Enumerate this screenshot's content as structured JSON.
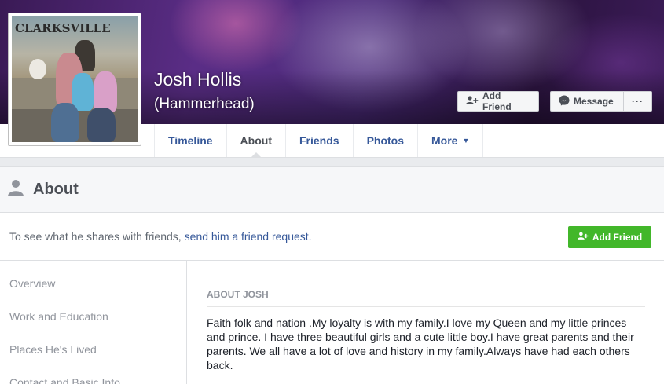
{
  "profile": {
    "name": "Josh Hollis",
    "alternate_name": "(Hammerhead)",
    "photo_sign_text": "CLARKSVILLE"
  },
  "cover_actions": {
    "add_friend_label": "Add Friend",
    "message_label": "Message",
    "more_label": "···"
  },
  "tabs": [
    {
      "label": "Timeline"
    },
    {
      "label": "About"
    },
    {
      "label": "Friends"
    },
    {
      "label": "Photos"
    },
    {
      "label": "More"
    }
  ],
  "about": {
    "title": "About",
    "banner_text": "To see what he shares with friends,",
    "banner_link": "send him a friend request.",
    "add_friend_label": "Add Friend"
  },
  "side_nav": [
    {
      "label": "Overview"
    },
    {
      "label": "Work and Education"
    },
    {
      "label": "Places He's Lived"
    },
    {
      "label": "Contact and Basic Info"
    }
  ],
  "about_content": {
    "heading": "ABOUT JOSH",
    "bio": "Faith folk and nation .My loyalty is with my family.I love my Queen and my little princes and prince. I have three beautiful girls and a cute little boy.I have great parents and their parents. We all have a lot of love and history in my family.Always have had each others back."
  },
  "colors": {
    "link_blue": "#365899",
    "green_button": "#42b72a",
    "page_bg": "#e9ebee"
  },
  "icons": [
    "person-plus-icon",
    "messenger-icon",
    "more-dots-icon",
    "caret-down-icon",
    "person-silhouette-icon"
  ]
}
